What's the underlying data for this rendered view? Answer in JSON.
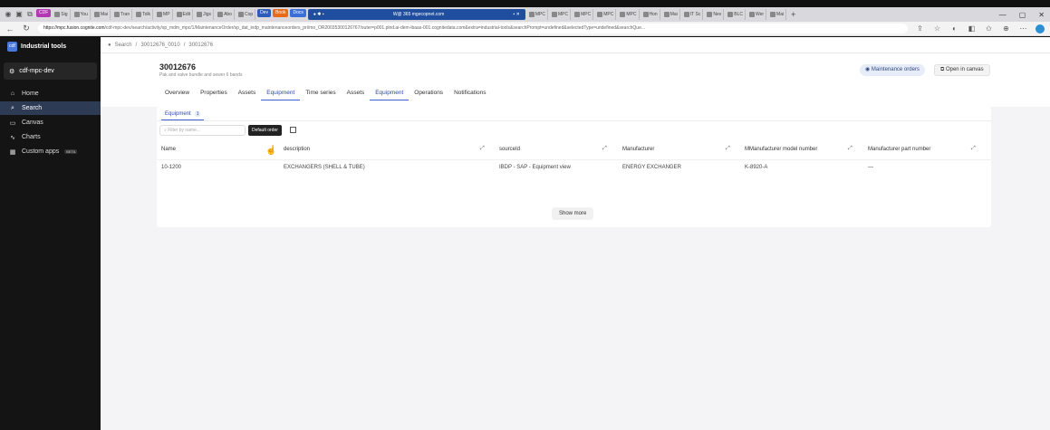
{
  "browser": {
    "tabs": [
      {
        "label": "CDF",
        "color": "#b338b3",
        "chip": true
      },
      {
        "label": "Sig"
      },
      {
        "label": "You"
      },
      {
        "label": "Mai"
      },
      {
        "label": "Tran"
      },
      {
        "label": "Tolk"
      },
      {
        "label": "MP"
      },
      {
        "label": "Edit"
      },
      {
        "label": "Jigs"
      },
      {
        "label": "Abo"
      },
      {
        "label": "Cop"
      },
      {
        "label": "Dev",
        "color": "#2f5bb8",
        "chip": true
      },
      {
        "label": "Book",
        "color": "#e86a1a",
        "chip": true
      },
      {
        "label": "Docs",
        "color": "#3a6fd8",
        "chip": true
      }
    ],
    "center_tab_label": "W@ 365 mgecopnet.com",
    "tabs_right": [
      "MPC",
      "MPC",
      "MPC",
      "MPC",
      "MPC",
      "Hon",
      "Mai",
      "IT Sc",
      "Nev",
      "BLC",
      "Wer",
      "Mai"
    ],
    "url_host": "https://mpc.fusion.cognite.com",
    "url_rest": "/cdf-mpc-dev/search/activity/sp_mdm_mpc/1/MaintenanceOrder/sp_dat_indp_maintenanceorders_pri/mo_OR20035300126767/outer=p001.plnd.ai-dem-ibaas-001.cognitedata.com&extra=industrial-tools&searchPrompt=undefined&selectedType=undefined&searchQue..."
  },
  "sidebar": {
    "app_name": "Industrial tools",
    "app_logo": "cdf",
    "project": "cdf-mpc-dev",
    "items": [
      {
        "label": "Home",
        "icon": "home-icon",
        "glyph": "⌂"
      },
      {
        "label": "Search",
        "icon": "search-icon",
        "glyph": "⌕",
        "active": true
      },
      {
        "label": "Canvas",
        "icon": "canvas-icon",
        "glyph": "▭"
      },
      {
        "label": "Charts",
        "icon": "chart-icon",
        "glyph": "∿"
      },
      {
        "label": "Custom apps",
        "icon": "apps-icon",
        "glyph": "▦",
        "badge": "BETA"
      }
    ]
  },
  "breadcrumb": [
    "Search",
    "30012676_0010",
    "30012676"
  ],
  "header": {
    "title": "30012676",
    "subtitle": "Pak and valve bundle and sewer 6 bands",
    "btn_maintenance_orders": "Maintenance orders",
    "btn_open_canvas": "Open in canvas",
    "tabs": [
      "Overview",
      "Properties",
      "Assets",
      "Equipment",
      "Time series",
      "Assets",
      "Equipment",
      "Operations",
      "Notifications"
    ],
    "active_tabs": [
      3,
      6
    ]
  },
  "card": {
    "subtab_label": "Equipment",
    "subtab_count": "1",
    "filter_placeholder": "Filter by name...",
    "tooltip": "Default order",
    "columns": [
      "Name",
      "description",
      "sourceId",
      "Manufacturer",
      "MManufacturer model number",
      "Manufacturer part number"
    ],
    "row": [
      "10-1200",
      "EXCHANGERS (SHELL & TUBE)",
      "IBDP - SAP - Equipment view",
      "ENERGY EXCHANGER",
      "K-8920-A",
      "—"
    ],
    "show_more": "Show more"
  },
  "colors": {
    "accent": "#3b5fd0",
    "sidebar_bg": "#141414",
    "sidebar_active": "#2e3b55"
  }
}
